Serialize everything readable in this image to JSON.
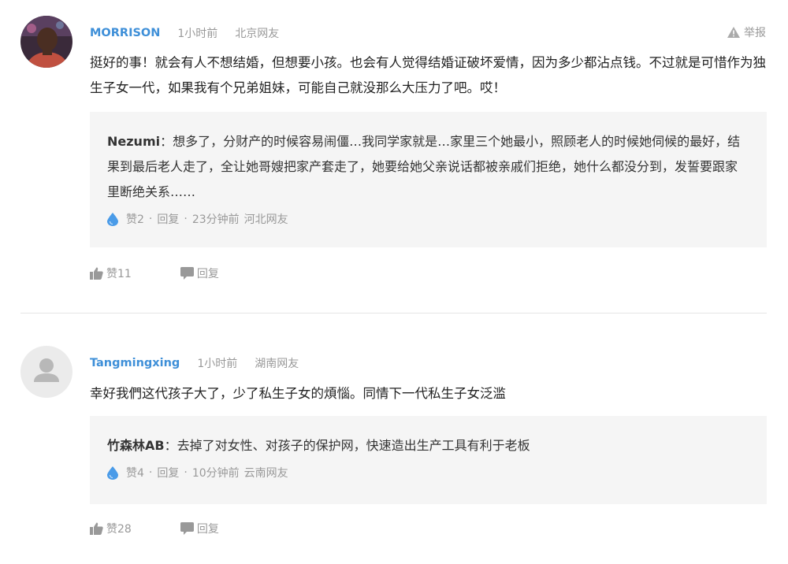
{
  "comments": [
    {
      "username": "MORRISON",
      "time": "1小时前",
      "location": "北京网友",
      "report_label": "举报",
      "text": "挺好的事！就会有人不想结婚，但想要小孩。也会有人觉得结婚证破坏爱情，因为多少都沾点钱。不过就是可惜作为独生子女一代，如果我有个兄弟姐妹，可能自己就没那么大压力了吧。哎！",
      "reply": {
        "author": "Nezumi",
        "separator": "：",
        "text": "想多了，分财产的时候容易闹僵…我同学家就是…家里三个她最小，照顾老人的时候她伺候的最好，结果到最后老人走了，全让她哥嫂把家产套走了，她要给她父亲说话都被亲戚们拒绝，她什么都没分到，发誓要跟家里断绝关系……",
        "likes": "赞2",
        "reply_label": "回复",
        "time": "23分钟前",
        "location": "河北网友"
      },
      "likes": "赞11",
      "reply_label": "回复"
    },
    {
      "username": "Tangmingxing",
      "time": "1小时前",
      "location": "湖南网友",
      "text": "幸好我們这代孩子大了，少了私生子女的煩惱。同情下一代私生子女泛滥",
      "reply": {
        "author": "竹森林AB",
        "separator": "：",
        "text": "去掉了对女性、对孩子的保护网，快速造出生产工具有利于老板",
        "likes": "赞4",
        "reply_label": "回复",
        "time": "10分钟前",
        "location": "云南网友"
      },
      "likes": "赞28",
      "reply_label": "回复"
    }
  ],
  "colors": {
    "username": "#3e8fd8",
    "meta": "#999999",
    "reply_bg": "#f5f5f5",
    "drop_icon": "#4a9be8"
  },
  "icons": [
    "user-photo-avatar",
    "default-user-avatar",
    "warning-triangle-icon",
    "water-drop-icon",
    "thumbs-up-icon",
    "speech-bubble-icon"
  ]
}
